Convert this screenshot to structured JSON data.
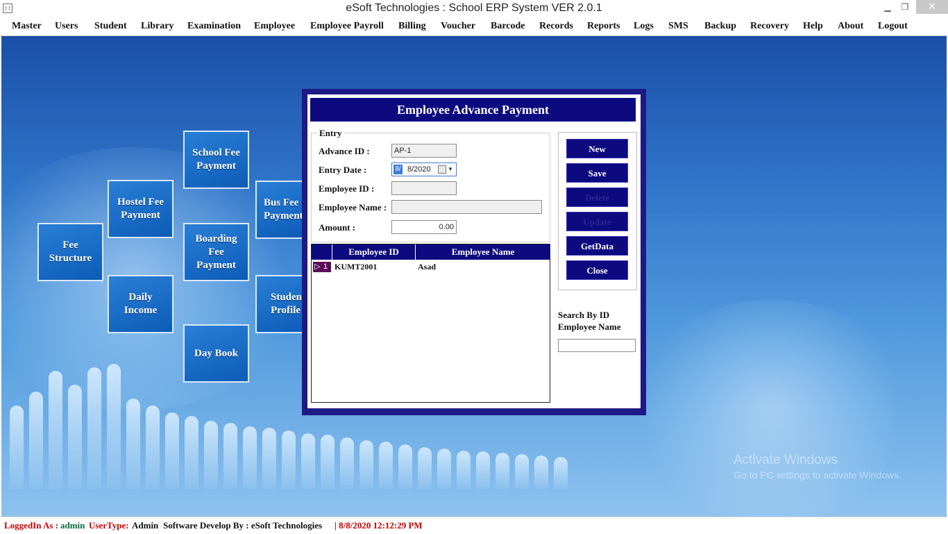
{
  "window": {
    "title": "eSoft Technologies : School ERP System VER 2.0.1",
    "icon": "app-icon",
    "min": "▁",
    "restore": "❐",
    "close": "✕"
  },
  "menu": [
    "Master",
    "Users",
    "Student",
    "Library",
    "Examination",
    "Employee",
    "Employee Payroll",
    "Billing",
    "Voucher",
    "Barcode",
    "Records",
    "Reports",
    "Logs",
    "SMS",
    "Backup",
    "Recovery",
    "Help",
    "About",
    "Logout"
  ],
  "tiles": {
    "school_fee": [
      "School Fee",
      "Payment"
    ],
    "hostel_fee": [
      "Hostel Fee",
      "Payment"
    ],
    "bus_fee": [
      "Bus Fee",
      "Payment"
    ],
    "fee_structure": [
      "Fee",
      "Structure"
    ],
    "boarding_fee": [
      "Boarding",
      "Fee",
      "Payment"
    ],
    "daily_income": [
      "Daily",
      "Income"
    ],
    "student_profile": [
      "Student",
      "Profile"
    ],
    "day_book": [
      "Day Book"
    ]
  },
  "dialog": {
    "title": "Employee Advance Payment",
    "entry_legend": "Entry",
    "labels": {
      "advance_id": "Advance ID :",
      "entry_date": "Entry Date :",
      "employee_id": "Employee ID :",
      "employee_name": "Employee Name :",
      "amount": "Amount :"
    },
    "values": {
      "advance_id": "AP-1",
      "entry_date_part": "8/",
      "entry_date": "8/2020",
      "employee_id": "",
      "employee_name": "",
      "amount": "0.00"
    },
    "grid": {
      "columns": [
        "Employee ID",
        "Employee Name"
      ],
      "rows": [
        {
          "num": "1",
          "employee_id": "KUMT2001",
          "employee_name": "Asad"
        }
      ]
    },
    "buttons": {
      "new": "New",
      "save": "Save",
      "delete": "Delete",
      "update": "Update",
      "getdata": "GetData",
      "close": "Close"
    },
    "search": {
      "label1": "Search By ID",
      "label2": "Employee Name",
      "value": ""
    }
  },
  "watermark": {
    "line1": "Activate Windows",
    "line2": "Go to PC settings to activate Windows."
  },
  "status": {
    "logged_label": "LoggedIn As :",
    "user": "admin",
    "usertype_label": "UserType:",
    "usertype": "Admin",
    "developer": "Software Develop By : eSoft Technologies",
    "datetime": "| 8/8/2020 12:12:29 PM"
  },
  "colors": {
    "dialog_border": "#1d1a86",
    "header_blue": "#0d0a80",
    "status_red": "#cc0000",
    "status_green": "#0a6b3a"
  }
}
